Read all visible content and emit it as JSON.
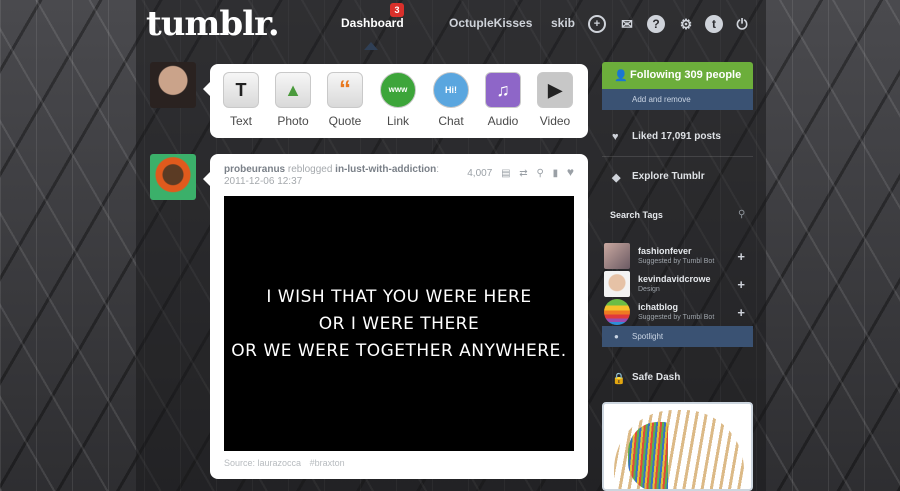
{
  "header": {
    "logo": "tumblr.",
    "nav": {
      "dashboard": "Dashboard",
      "dashboard_badge": "3",
      "blog": "OctupleKisses",
      "skib": "skib"
    },
    "icons": [
      "plus-icon",
      "mail-icon",
      "help-icon",
      "gear-icon",
      "tumblr-t-icon",
      "power-icon"
    ]
  },
  "post_types": [
    {
      "label": "Text",
      "icon": "text-icon",
      "glyph": "T"
    },
    {
      "label": "Photo",
      "icon": "photo-icon",
      "glyph": "▲"
    },
    {
      "label": "Quote",
      "icon": "quote-icon",
      "glyph": "“"
    },
    {
      "label": "Link",
      "icon": "link-icon",
      "glyph": "www"
    },
    {
      "label": "Chat",
      "icon": "chat-icon",
      "glyph": "Hi!"
    },
    {
      "label": "Audio",
      "icon": "audio-icon",
      "glyph": "♫"
    },
    {
      "label": "Video",
      "icon": "video-icon",
      "glyph": "▶"
    }
  ],
  "post": {
    "author": "probeuranus",
    "action": "reblogged",
    "source": "in-lust-with-addiction",
    "date": "2011-12-06 12:37",
    "notes": "4,007",
    "image_text": [
      "I WISH THAT YOU WERE HERE",
      "OR I WERE THERE",
      "OR WE WERE TOGETHER ANYWHERE."
    ],
    "footer_source": "Source: laurazocca",
    "footer_tag": "#braxton"
  },
  "sidebar": {
    "following": "Following 309 people",
    "add_remove": "Add and remove",
    "liked": "Liked 17,091 posts",
    "explore": "Explore Tumblr",
    "search_tags": "Search Tags",
    "suggestions": [
      {
        "name": "fashionfever",
        "sub": "Suggested by Tumbl Bot"
      },
      {
        "name": "kevindavidcrowe",
        "sub": "Design"
      },
      {
        "name": "ichatblog",
        "sub": "Suggested by Tumbl Bot"
      }
    ],
    "spotlight": "Spotlight",
    "safe_dash": "Safe Dash"
  },
  "colors": {
    "following_green": "#6cae3b",
    "sidebar_blue": "#3a5273",
    "badge_red": "#d9302b"
  }
}
